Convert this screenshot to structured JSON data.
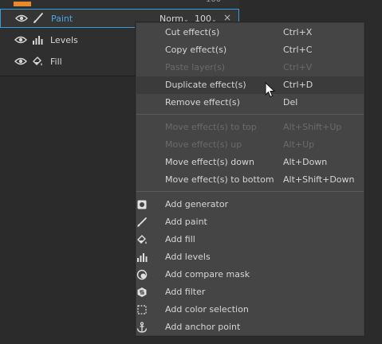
{
  "layers_panel": {
    "top_value": "100",
    "blend_mode": "Norm",
    "opacity": "100",
    "remove_symbol": "×",
    "layers": [
      {
        "name": "Paint",
        "icon": "brush-icon"
      },
      {
        "name": "Levels",
        "icon": "levels-icon"
      },
      {
        "name": "Fill",
        "icon": "fill-bucket-icon"
      }
    ]
  },
  "context_menu": {
    "items": [
      {
        "label": "Cut effect(s)",
        "shortcut": "Ctrl+X",
        "enabled": true
      },
      {
        "label": "Copy effect(s)",
        "shortcut": "Ctrl+C",
        "enabled": true
      },
      {
        "label": "Paste layer(s)",
        "shortcut": "Ctrl+V",
        "enabled": false
      },
      {
        "label": "Duplicate effect(s)",
        "shortcut": "Ctrl+D",
        "enabled": true,
        "highlighted": true
      },
      {
        "label": "Remove effect(s)",
        "shortcut": "Del",
        "enabled": true
      },
      {
        "label": "Move effect(s) to top",
        "shortcut": "Alt+Shift+Up",
        "enabled": false
      },
      {
        "label": "Move effect(s) up",
        "shortcut": "Alt+Up",
        "enabled": false
      },
      {
        "label": "Move effect(s) down",
        "shortcut": "Alt+Down",
        "enabled": true
      },
      {
        "label": "Move effect(s) to bottom",
        "shortcut": "Alt+Shift+Down",
        "enabled": true
      },
      {
        "label": "Add generator",
        "icon": "generator-icon",
        "enabled": true
      },
      {
        "label": "Add paint",
        "icon": "brush-icon",
        "enabled": true
      },
      {
        "label": "Add fill",
        "icon": "fill-bucket-icon",
        "enabled": true
      },
      {
        "label": "Add levels",
        "icon": "levels-icon",
        "enabled": true
      },
      {
        "label": "Add compare mask",
        "icon": "compare-mask-icon",
        "enabled": true
      },
      {
        "label": "Add filter",
        "icon": "filter-icon",
        "enabled": true
      },
      {
        "label": "Add color selection",
        "icon": "color-selection-icon",
        "enabled": true
      },
      {
        "label": "Add anchor point",
        "icon": "anchor-icon",
        "enabled": true
      }
    ]
  },
  "colors": {
    "accent": "#e9892d",
    "selection_border": "#2f9fe0",
    "menu_bg": "#454545",
    "menu_highlight": "#3b3b3b"
  }
}
